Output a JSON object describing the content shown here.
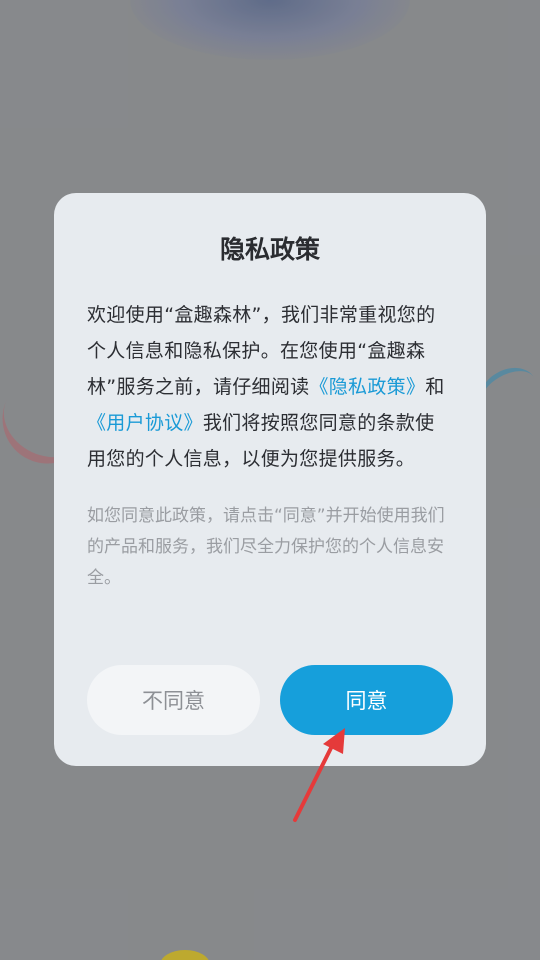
{
  "dialog": {
    "title": "隐私政策",
    "body_part1": "欢迎使用“盒趣森林”，我们非常重视您的个人信息和隐私保护。在您使用“盒趣森林”服务之前，请仔细阅读",
    "privacy_link": "《隐私政策》",
    "body_and": "和",
    "user_agreement_link": "《用户协议》",
    "body_part2": "我们将按照您同意的条款使用您的个人信息，以便为您提供服务。",
    "note": "如您同意此政策，请点击“同意”并开始使用我们的产品和服务，我们尽全力保护您的个人信息安全。",
    "disagree_label": "不同意",
    "agree_label": "同意"
  },
  "colors": {
    "link": "#1a9ad6",
    "agree_button": "#169fdb",
    "annotation_arrow": "#e53a3a"
  }
}
